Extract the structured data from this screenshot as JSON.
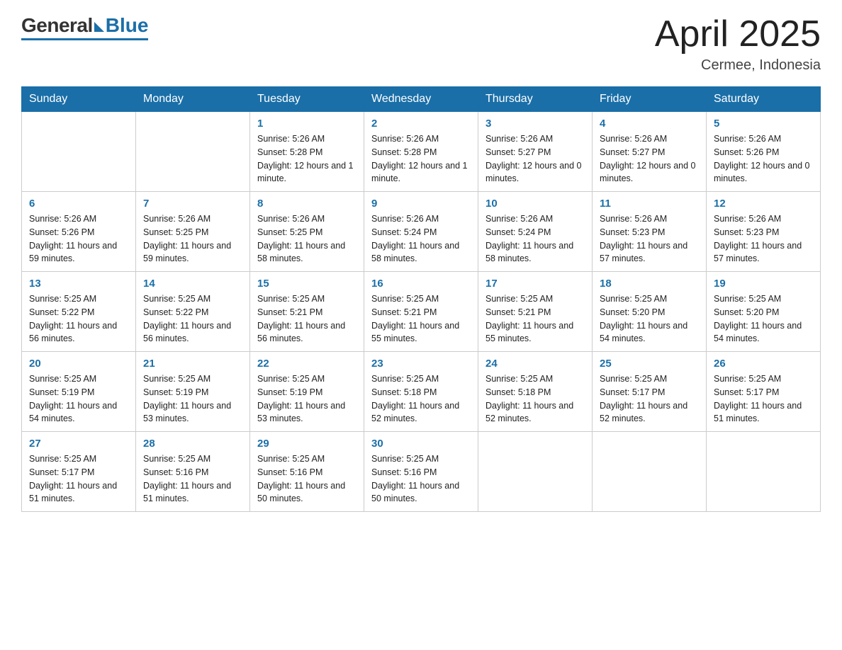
{
  "header": {
    "logo_general": "General",
    "logo_blue": "Blue",
    "title": "April 2025",
    "subtitle": "Cermee, Indonesia"
  },
  "days_of_week": [
    "Sunday",
    "Monday",
    "Tuesday",
    "Wednesday",
    "Thursday",
    "Friday",
    "Saturday"
  ],
  "weeks": [
    [
      {
        "num": "",
        "info": ""
      },
      {
        "num": "",
        "info": ""
      },
      {
        "num": "1",
        "info": "Sunrise: 5:26 AM\nSunset: 5:28 PM\nDaylight: 12 hours\nand 1 minute."
      },
      {
        "num": "2",
        "info": "Sunrise: 5:26 AM\nSunset: 5:28 PM\nDaylight: 12 hours\nand 1 minute."
      },
      {
        "num": "3",
        "info": "Sunrise: 5:26 AM\nSunset: 5:27 PM\nDaylight: 12 hours\nand 0 minutes."
      },
      {
        "num": "4",
        "info": "Sunrise: 5:26 AM\nSunset: 5:27 PM\nDaylight: 12 hours\nand 0 minutes."
      },
      {
        "num": "5",
        "info": "Sunrise: 5:26 AM\nSunset: 5:26 PM\nDaylight: 12 hours\nand 0 minutes."
      }
    ],
    [
      {
        "num": "6",
        "info": "Sunrise: 5:26 AM\nSunset: 5:26 PM\nDaylight: 11 hours\nand 59 minutes."
      },
      {
        "num": "7",
        "info": "Sunrise: 5:26 AM\nSunset: 5:25 PM\nDaylight: 11 hours\nand 59 minutes."
      },
      {
        "num": "8",
        "info": "Sunrise: 5:26 AM\nSunset: 5:25 PM\nDaylight: 11 hours\nand 58 minutes."
      },
      {
        "num": "9",
        "info": "Sunrise: 5:26 AM\nSunset: 5:24 PM\nDaylight: 11 hours\nand 58 minutes."
      },
      {
        "num": "10",
        "info": "Sunrise: 5:26 AM\nSunset: 5:24 PM\nDaylight: 11 hours\nand 58 minutes."
      },
      {
        "num": "11",
        "info": "Sunrise: 5:26 AM\nSunset: 5:23 PM\nDaylight: 11 hours\nand 57 minutes."
      },
      {
        "num": "12",
        "info": "Sunrise: 5:26 AM\nSunset: 5:23 PM\nDaylight: 11 hours\nand 57 minutes."
      }
    ],
    [
      {
        "num": "13",
        "info": "Sunrise: 5:25 AM\nSunset: 5:22 PM\nDaylight: 11 hours\nand 56 minutes."
      },
      {
        "num": "14",
        "info": "Sunrise: 5:25 AM\nSunset: 5:22 PM\nDaylight: 11 hours\nand 56 minutes."
      },
      {
        "num": "15",
        "info": "Sunrise: 5:25 AM\nSunset: 5:21 PM\nDaylight: 11 hours\nand 56 minutes."
      },
      {
        "num": "16",
        "info": "Sunrise: 5:25 AM\nSunset: 5:21 PM\nDaylight: 11 hours\nand 55 minutes."
      },
      {
        "num": "17",
        "info": "Sunrise: 5:25 AM\nSunset: 5:21 PM\nDaylight: 11 hours\nand 55 minutes."
      },
      {
        "num": "18",
        "info": "Sunrise: 5:25 AM\nSunset: 5:20 PM\nDaylight: 11 hours\nand 54 minutes."
      },
      {
        "num": "19",
        "info": "Sunrise: 5:25 AM\nSunset: 5:20 PM\nDaylight: 11 hours\nand 54 minutes."
      }
    ],
    [
      {
        "num": "20",
        "info": "Sunrise: 5:25 AM\nSunset: 5:19 PM\nDaylight: 11 hours\nand 54 minutes."
      },
      {
        "num": "21",
        "info": "Sunrise: 5:25 AM\nSunset: 5:19 PM\nDaylight: 11 hours\nand 53 minutes."
      },
      {
        "num": "22",
        "info": "Sunrise: 5:25 AM\nSunset: 5:19 PM\nDaylight: 11 hours\nand 53 minutes."
      },
      {
        "num": "23",
        "info": "Sunrise: 5:25 AM\nSunset: 5:18 PM\nDaylight: 11 hours\nand 52 minutes."
      },
      {
        "num": "24",
        "info": "Sunrise: 5:25 AM\nSunset: 5:18 PM\nDaylight: 11 hours\nand 52 minutes."
      },
      {
        "num": "25",
        "info": "Sunrise: 5:25 AM\nSunset: 5:17 PM\nDaylight: 11 hours\nand 52 minutes."
      },
      {
        "num": "26",
        "info": "Sunrise: 5:25 AM\nSunset: 5:17 PM\nDaylight: 11 hours\nand 51 minutes."
      }
    ],
    [
      {
        "num": "27",
        "info": "Sunrise: 5:25 AM\nSunset: 5:17 PM\nDaylight: 11 hours\nand 51 minutes."
      },
      {
        "num": "28",
        "info": "Sunrise: 5:25 AM\nSunset: 5:16 PM\nDaylight: 11 hours\nand 51 minutes."
      },
      {
        "num": "29",
        "info": "Sunrise: 5:25 AM\nSunset: 5:16 PM\nDaylight: 11 hours\nand 50 minutes."
      },
      {
        "num": "30",
        "info": "Sunrise: 5:25 AM\nSunset: 5:16 PM\nDaylight: 11 hours\nand 50 minutes."
      },
      {
        "num": "",
        "info": ""
      },
      {
        "num": "",
        "info": ""
      },
      {
        "num": "",
        "info": ""
      }
    ]
  ]
}
